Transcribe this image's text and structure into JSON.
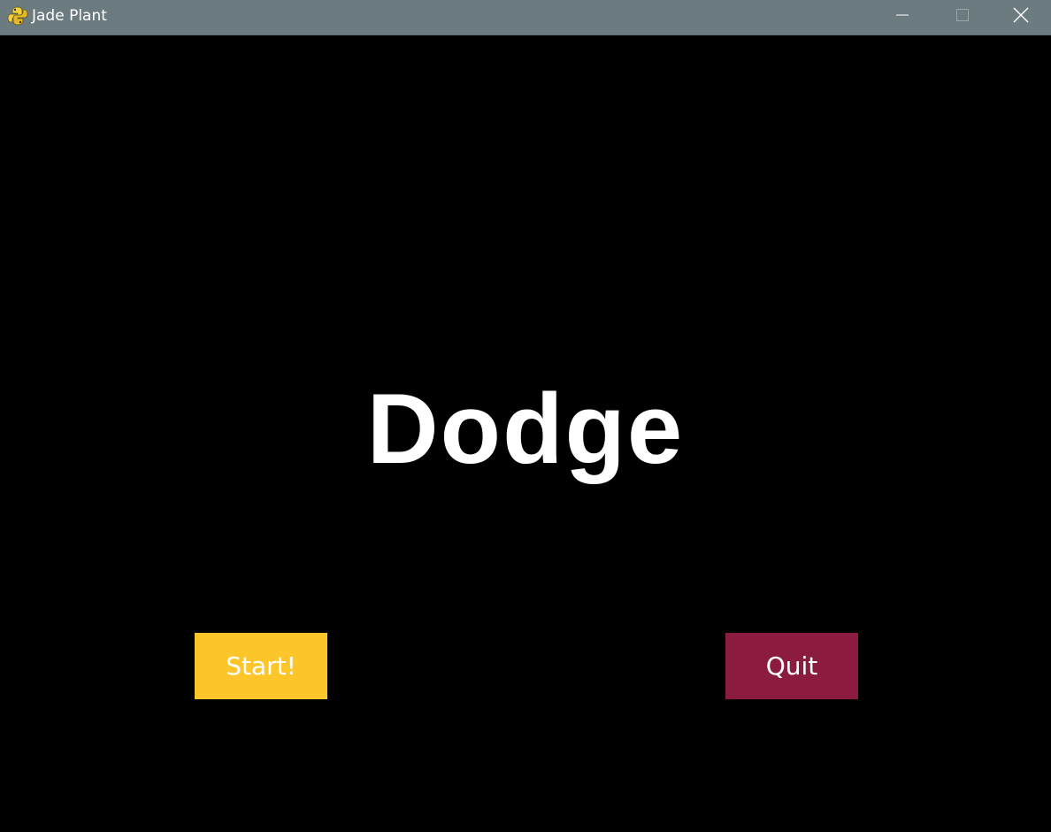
{
  "window": {
    "title": "Jade Plant",
    "app_icon": "python-icon",
    "controls": {
      "minimize": "minimize-icon",
      "maximize": "maximize-icon",
      "close": "close-icon"
    },
    "titlebar_color": "#6c7b7f"
  },
  "game": {
    "background_color": "#000000",
    "title": "Dodge",
    "buttons": {
      "start": {
        "label": "Start!",
        "color": "#fcc62a"
      },
      "quit": {
        "label": "Quit",
        "color": "#8b1c40"
      }
    }
  }
}
